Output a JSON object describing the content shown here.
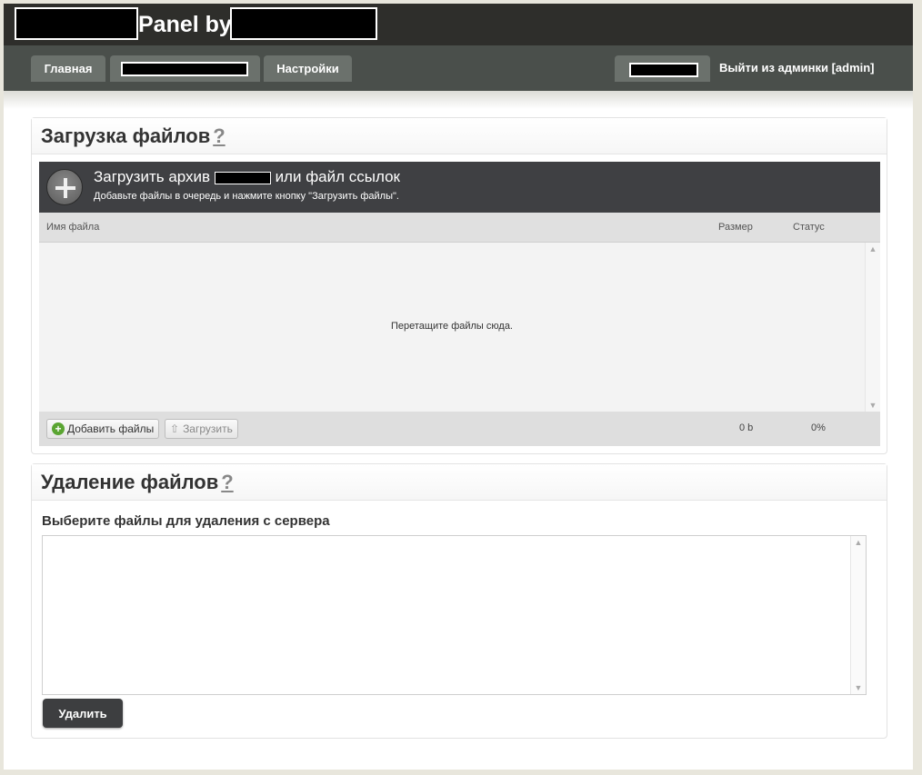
{
  "header": {
    "brand_text": "Panel by"
  },
  "nav": {
    "home": "Главная",
    "settings": "Настройки",
    "logout": "Выйти из админки [admin]"
  },
  "upload": {
    "title": "Загрузка файлов",
    "help": "?",
    "widget_title_prefix": "Загрузить архив",
    "widget_title_suffix": "или файл ссылок",
    "widget_subtitle": "Добавьте файлы в очередь и нажмите кнопку \"Загрузить файлы\".",
    "columns": [
      "Имя файла",
      "Размер",
      "Статус"
    ],
    "drop_text": "Перетащите файлы сюда.",
    "add_button": "Добавить файлы",
    "upload_button": "Загрузить",
    "total_size": "0 b",
    "total_percent": "0%",
    "scroll_up": "▲",
    "scroll_down": "▼"
  },
  "delete": {
    "title": "Удаление файлов",
    "help": "?",
    "label": "Выберите файлы для удаления с сервера",
    "button": "Удалить",
    "scroll_up": "▲",
    "scroll_down": "▼"
  },
  "colors": {
    "topbar": "#2e2e2b",
    "navbar": "#4a4f4b",
    "nav_button": "#6b716c",
    "upload_header": "#3f4043",
    "delete_button": "#3d3e40"
  }
}
